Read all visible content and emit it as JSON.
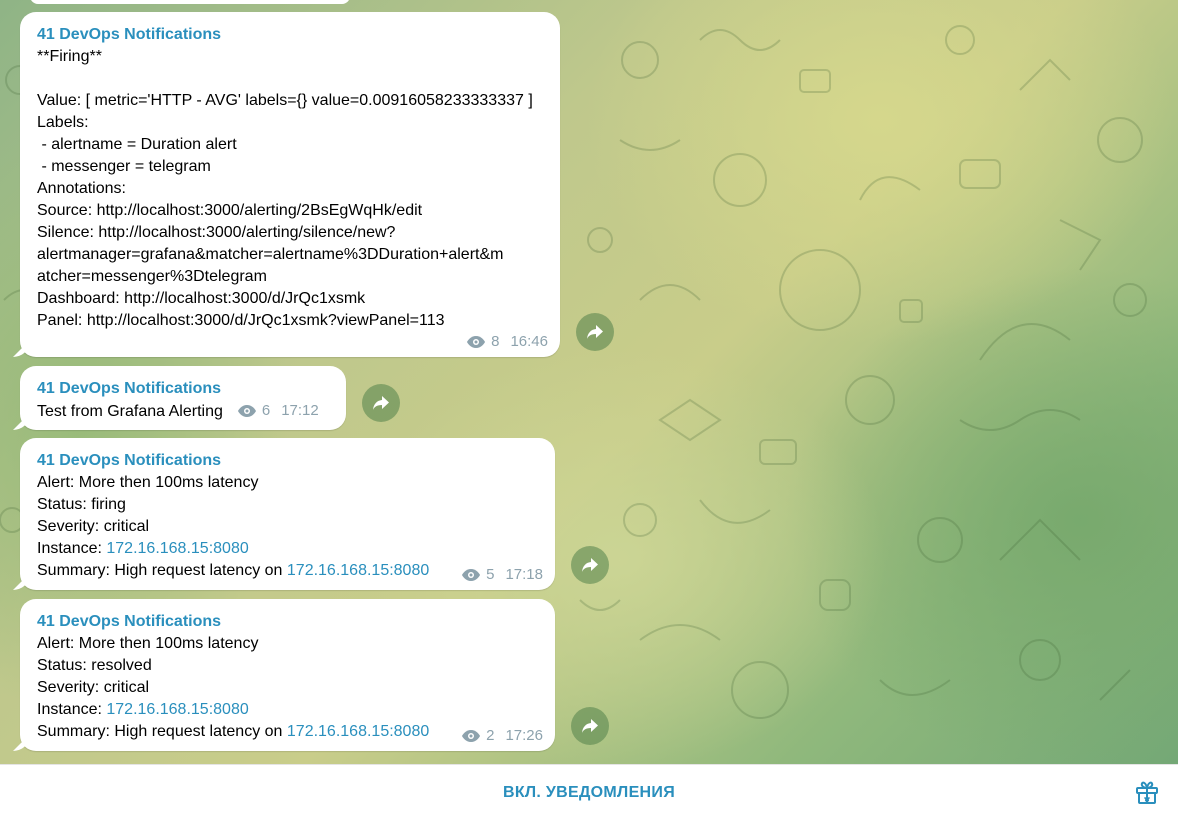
{
  "chat": {
    "messages": [
      {
        "sender": "41 DevOps Notifications",
        "lines": [
          "**Firing**",
          "",
          "Value: [ metric='HTTP - AVG' labels={} value=0.00916058233333337 ]",
          "Labels:",
          " - alertname = Duration alert",
          " - messenger = telegram",
          "Annotations:",
          "Source: http://localhost:3000/alerting/2BsEgWqHk/edit",
          "Silence: http://localhost:3000/alerting/silence/new?",
          "alertmanager=grafana&matcher=alertname%3DDuration+alert&m",
          "atcher=messenger%3Dtelegram",
          "Dashboard: http://localhost:3000/d/JrQc1xsmk",
          "Panel: http://localhost:3000/d/JrQc1xsmk?viewPanel=113"
        ],
        "views": "8",
        "time": "16:46"
      },
      {
        "sender": "41 DevOps Notifications",
        "text": "Test from Grafana Alerting",
        "views": "6",
        "time": "17:12"
      },
      {
        "sender": "41 DevOps Notifications",
        "alert": "Alert: More then 100ms latency",
        "status": "Status: firing",
        "severity": "Severity: critical",
        "instance_label": "Instance: ",
        "instance": "172.16.168.15:8080",
        "summary_label": "Summary: High request latency on ",
        "summary_instance": "172.16.168.15:8080",
        "views": "5",
        "time": "17:18"
      },
      {
        "sender": "41 DevOps Notifications",
        "alert": "Alert: More then 100ms latency",
        "status": "Status: resolved",
        "severity": "Severity: critical",
        "instance_label": "Instance: ",
        "instance": "172.16.168.15:8080",
        "summary_label": "Summary: High request latency on ",
        "summary_instance": "172.16.168.15:8080",
        "views": "2",
        "time": "17:26"
      }
    ]
  },
  "bottom_bar": {
    "unmute_label": "ВКЛ. УВЕДОМЛЕНИЯ",
    "gift_icon": "gift-icon"
  },
  "icons": {
    "views": "eye-icon",
    "share": "share-arrow-icon"
  },
  "colors": {
    "accent": "#2a8fbd",
    "meta": "#8da2ad",
    "bubble": "#ffffff"
  }
}
